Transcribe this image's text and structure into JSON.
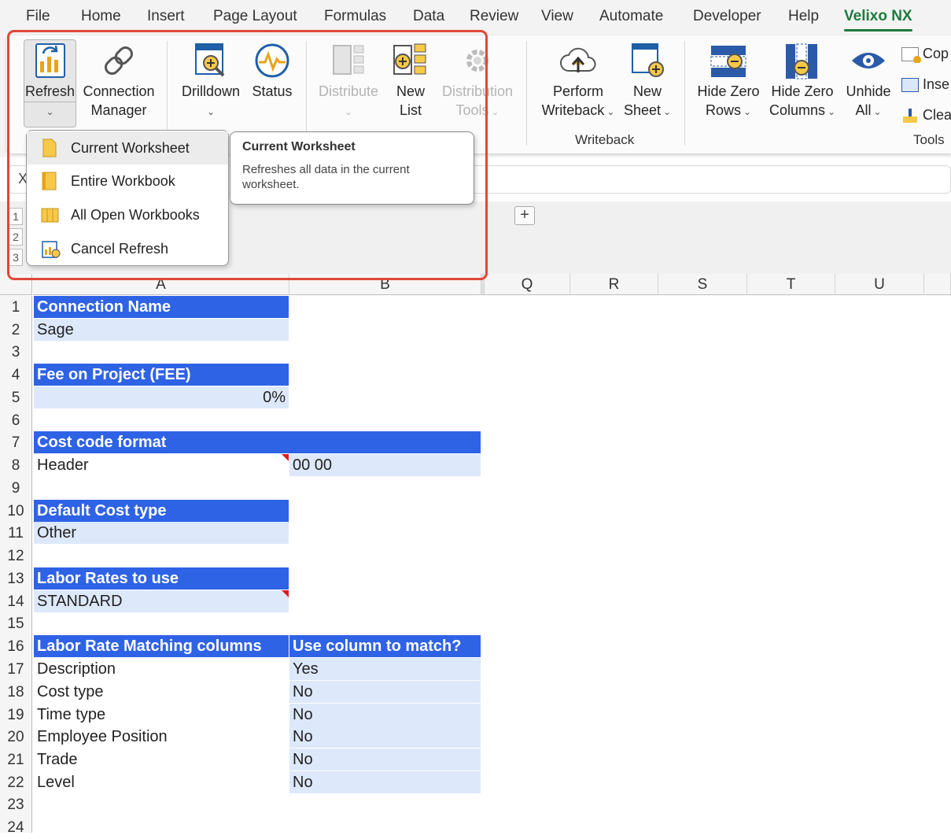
{
  "menu": {
    "tabs": [
      "File",
      "Home",
      "Insert",
      "Page Layout",
      "Formulas",
      "Data",
      "Review",
      "View",
      "Automate",
      "Developer",
      "Help",
      "Velixo NX"
    ],
    "active_tab": "Velixo NX"
  },
  "ribbon": {
    "refresh": "Refresh",
    "connection_manager": [
      "Connection",
      "Manager"
    ],
    "drilldown": "Drilldown",
    "status": "Status",
    "distribute": "Distribute",
    "new_list": [
      "New",
      "List"
    ],
    "distribution_tools": [
      "Distribution",
      "Tools"
    ],
    "perform_writeback": [
      "Perform",
      "Writeback"
    ],
    "new_sheet": [
      "New",
      "Sheet"
    ],
    "writeback_group": "Writeback",
    "hide_zero_rows": [
      "Hide Zero",
      "Rows"
    ],
    "hide_zero_columns": [
      "Hide Zero",
      "Columns"
    ],
    "unhide_all": [
      "Unhide",
      "All"
    ],
    "copy": "Cop",
    "insert": "Inse",
    "clear": "Clea",
    "tools_group": "Tools"
  },
  "refresh_menu": {
    "items": [
      "Current Worksheet",
      "Entire Workbook",
      "All Open Workbooks",
      "Cancel Refresh"
    ],
    "hovered": "Current Worksheet"
  },
  "tooltip": {
    "title": "Current Worksheet",
    "body": "Refreshes all data in the current worksheet."
  },
  "formula_bar": {
    "name_box_fragment": "X"
  },
  "sheet_strip": {
    "plus": "+",
    "outline_levels": [
      "1",
      "2",
      "3"
    ]
  },
  "grid": {
    "columns": [
      "A",
      "B",
      "Q",
      "R",
      "S",
      "T",
      "U"
    ],
    "rows": [
      "1",
      "2",
      "3",
      "4",
      "5",
      "6",
      "7",
      "8",
      "9",
      "10",
      "11",
      "12",
      "13",
      "14",
      "15",
      "16",
      "17",
      "18",
      "19",
      "20",
      "21",
      "22",
      "23",
      "24"
    ],
    "cells": {
      "A1": "Connection Name",
      "A2": "Sage",
      "A4": "Fee on Project (FEE)",
      "A5": "0%",
      "A7": "Cost code format",
      "A8": "Header",
      "B8": "00 00",
      "A10": "Default Cost type",
      "A11": "Other",
      "A13": "Labor Rates to use",
      "A14": "STANDARD",
      "A16": "Labor Rate Matching columns",
      "B16": "Use column to match?",
      "A17": "Description",
      "B17": "Yes",
      "A18": "Cost type",
      "B18": "No",
      "A19": "Time type",
      "B19": "No",
      "A20": "Employee Position",
      "B20": "No",
      "A21": "Trade",
      "B21": "No",
      "A22": "Level",
      "B22": "No"
    }
  },
  "colors": {
    "header_fill": "#2f63e6",
    "value_fill": "#dde8fb",
    "highlight_border": "#e0473a",
    "active_tab": "#1e7a3c"
  }
}
